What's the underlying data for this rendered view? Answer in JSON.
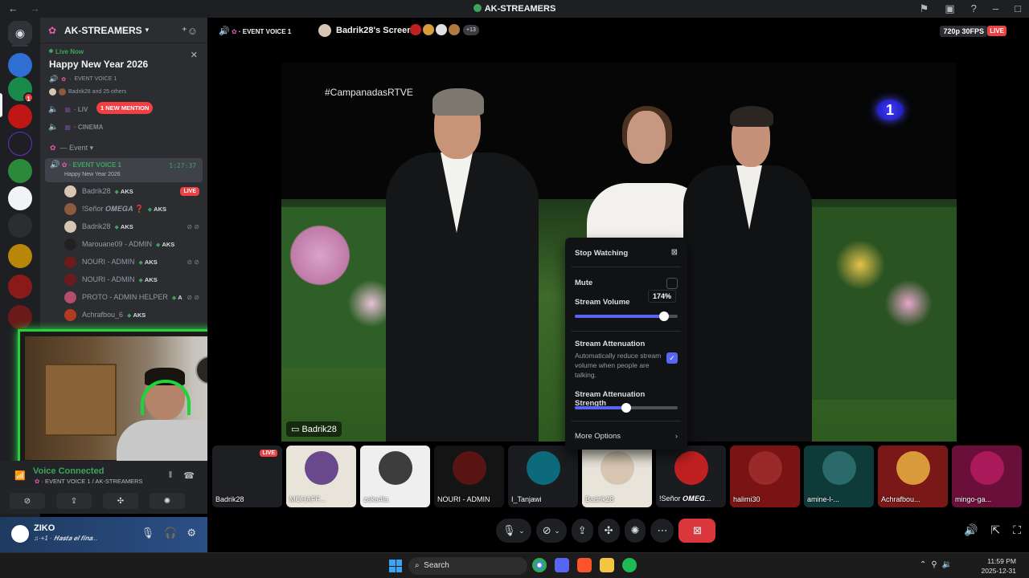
{
  "window": {
    "title": "AK-STREAMERS"
  },
  "server": {
    "name": "AK-STREAMERS"
  },
  "live_now": {
    "label": "Live Now",
    "event": "Happy New Year 2026",
    "channel": "EVENT VOICE 1",
    "participants": "Badrik28 and 25 others"
  },
  "channels": [
    {
      "name": "LIV",
      "mention": "1 NEW MENTION"
    },
    {
      "name": "CINEMA"
    }
  ],
  "category": "Event",
  "active_channel": {
    "name": "EVENT VOICE 1",
    "timer": "1:27:37",
    "description": "Happy New Year 2026"
  },
  "members": [
    {
      "name": "Badrik28",
      "tag": "AKS",
      "live": "LIVE",
      "color": "#d7c6b2"
    },
    {
      "name": "!Señor 𝑶𝑴𝑬𝑮𝑨 ❓",
      "tag": "AKS",
      "color": "#8c5a3c"
    },
    {
      "name": "Badrik28",
      "tag": "AKS",
      "color": "#d7c6b2"
    },
    {
      "name": "Marouane09 - ADMIN",
      "tag": "AKS",
      "color": "#222222"
    },
    {
      "name": "NOURI - ADMIN",
      "tag": "AKS",
      "color": "#6b1b1b"
    },
    {
      "name": "NOURI - ADMIN",
      "tag": "AKS",
      "color": "#6b1b1b"
    },
    {
      "name": "PROTO - ADMIN HELPER",
      "tag": "A",
      "color": "#b24d6e"
    },
    {
      "name": "Achrafbou_6",
      "tag": "AKS",
      "color": "#b23b22"
    }
  ],
  "voice": {
    "status": "Voice Connected",
    "location": "EVENT VOICE 1 / AK-STREAMERS"
  },
  "user": {
    "name": "ZIKO",
    "status": "𝑯𝒂𝒔𝒕𝒂 𝒆𝒍 𝒇𝒊𝒏𝒂..."
  },
  "stream": {
    "channel": "EVENT VOICE 1",
    "title": "Badrik28's Screen",
    "viewers_more": "+13",
    "quality": "720p 30FPS",
    "live": "LIVE",
    "hashtag": "#CampanadasRTVE",
    "broadcaster_logo": "1",
    "streamer_label": "Badrik28"
  },
  "popup": {
    "stop_watching": "Stop Watching",
    "mute": "Mute",
    "mute_checked": false,
    "stream_volume": "Stream Volume",
    "volume_value": "174%",
    "volume_fraction": 0.87,
    "attenuation": "Stream Attenuation",
    "attenuation_desc": "Automatically reduce stream volume when people are talking.",
    "attenuation_checked": true,
    "attenuation_strength": "Stream Attenuation Strength",
    "strength_fraction": 0.5,
    "more_options": "More Options"
  },
  "tiles": [
    {
      "name": "Badrik28",
      "bg": "#1e1f22",
      "live": "LIVE"
    },
    {
      "name": "MOHAFF...",
      "bg": "#e8e4da",
      "circle": "#6a4a8c"
    },
    {
      "name": "zaka4ia",
      "bg": "#efefef",
      "circle": "#3d3d3d"
    },
    {
      "name": "NOURI - ADMIN",
      "bg": "#141414",
      "circle": "#5a1414"
    },
    {
      "name": "I_Tanjawi",
      "bg": "#1a1c20",
      "circle": "#0d6a7a"
    },
    {
      "name": "Badrik28",
      "bg": "#e8e4da",
      "circle": "#d7c6b2"
    },
    {
      "name": "!Señor 𝑶𝑴𝑬𝑮...",
      "bg": "#1a1c20",
      "circle": "#c02020"
    },
    {
      "name": "halimi30",
      "bg": "#7a1414",
      "circle": "#9a2a2a"
    },
    {
      "name": "amine-l-...",
      "bg": "#0f3a3a",
      "circle": "#2a6a6a"
    },
    {
      "name": "Achrafbou...",
      "bg": "#7a1818",
      "circle": "#d89a3a"
    },
    {
      "name": "mingo-ga...",
      "bg": "#6a0f3a",
      "circle": "#aa1a5a"
    }
  ],
  "taskbar": {
    "search": "Search",
    "time": "11:59 PM",
    "date": "2025-12-31"
  }
}
